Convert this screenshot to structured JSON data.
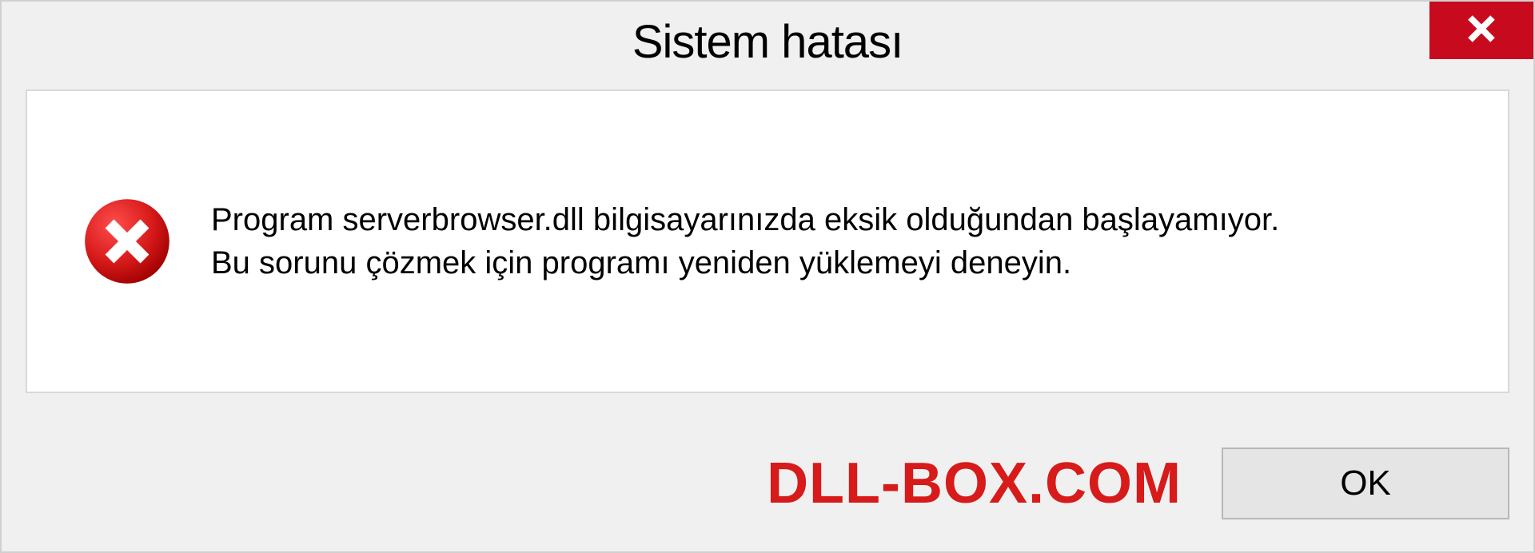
{
  "dialog": {
    "title": "Sistem hatası",
    "message_line1": "Program serverbrowser.dll bilgisayarınızda eksik olduğundan başlayamıyor.",
    "message_line2": "Bu sorunu çözmek için programı yeniden yüklemeyi deneyin.",
    "ok_label": "OK"
  },
  "watermark": "DLL-BOX.COM",
  "colors": {
    "close_bg": "#c80a1e",
    "error_icon": "#d71a1a",
    "watermark": "#d71a1a"
  }
}
